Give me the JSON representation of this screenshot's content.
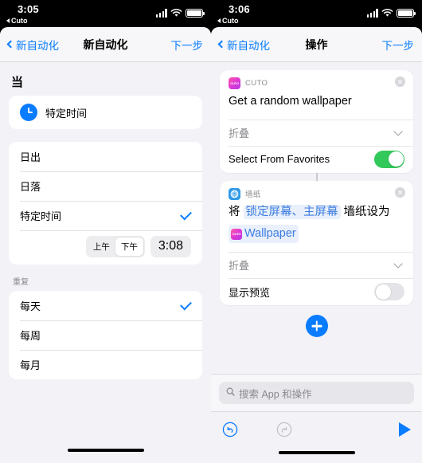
{
  "left": {
    "status": {
      "time": "3:05",
      "back_app": "Cuto"
    },
    "nav": {
      "back": "新自动化",
      "title": "新自动化",
      "next": "下一步"
    },
    "when_header": "当",
    "trigger": {
      "label": "特定时间",
      "icon": "clock-icon"
    },
    "options": [
      {
        "label": "日出",
        "checked": false
      },
      {
        "label": "日落",
        "checked": false
      },
      {
        "label": "特定时间",
        "checked": true
      }
    ],
    "time_picker": {
      "am": "上午",
      "pm": "下午",
      "selected": "下午",
      "time": "3:08"
    },
    "repeat_header": "重复",
    "repeat_options": [
      {
        "label": "每天",
        "checked": true
      },
      {
        "label": "每周",
        "checked": false
      },
      {
        "label": "每月",
        "checked": false
      }
    ]
  },
  "right": {
    "status": {
      "time": "3:06",
      "back_app": "Cuto"
    },
    "nav": {
      "back": "新自动化",
      "title": "操作",
      "next": "下一步"
    },
    "cards": [
      {
        "app": "CUTO",
        "app_icon": "cuto-app-icon",
        "title": "Get a random wallpaper",
        "collapse_label": "折叠",
        "toggle_label": "Select From Favorites",
        "toggle_on": true
      },
      {
        "app": "墙纸",
        "app_icon": "wallpaper-app-icon",
        "text_prefix": "将 ",
        "token1": "锁定屏幕、主屏幕",
        "text_middle": " 墙纸设为",
        "token2": "Wallpaper",
        "collapse_label": "折叠",
        "toggle_label": "显示预览",
        "toggle_on": false
      }
    ],
    "add_button": "add-action-button",
    "search": {
      "placeholder": "搜索 App 和操作",
      "icon": "search-icon"
    },
    "toolbar": {
      "undo": "undo-icon",
      "redo": "redo-icon",
      "run": "run-icon"
    }
  },
  "colors": {
    "accent": "#0a7cff",
    "toggle_on": "#32c85a",
    "token_text": "#3b7de0",
    "token_bg": "#e9effb",
    "page_bg": "#f2f2f7"
  }
}
